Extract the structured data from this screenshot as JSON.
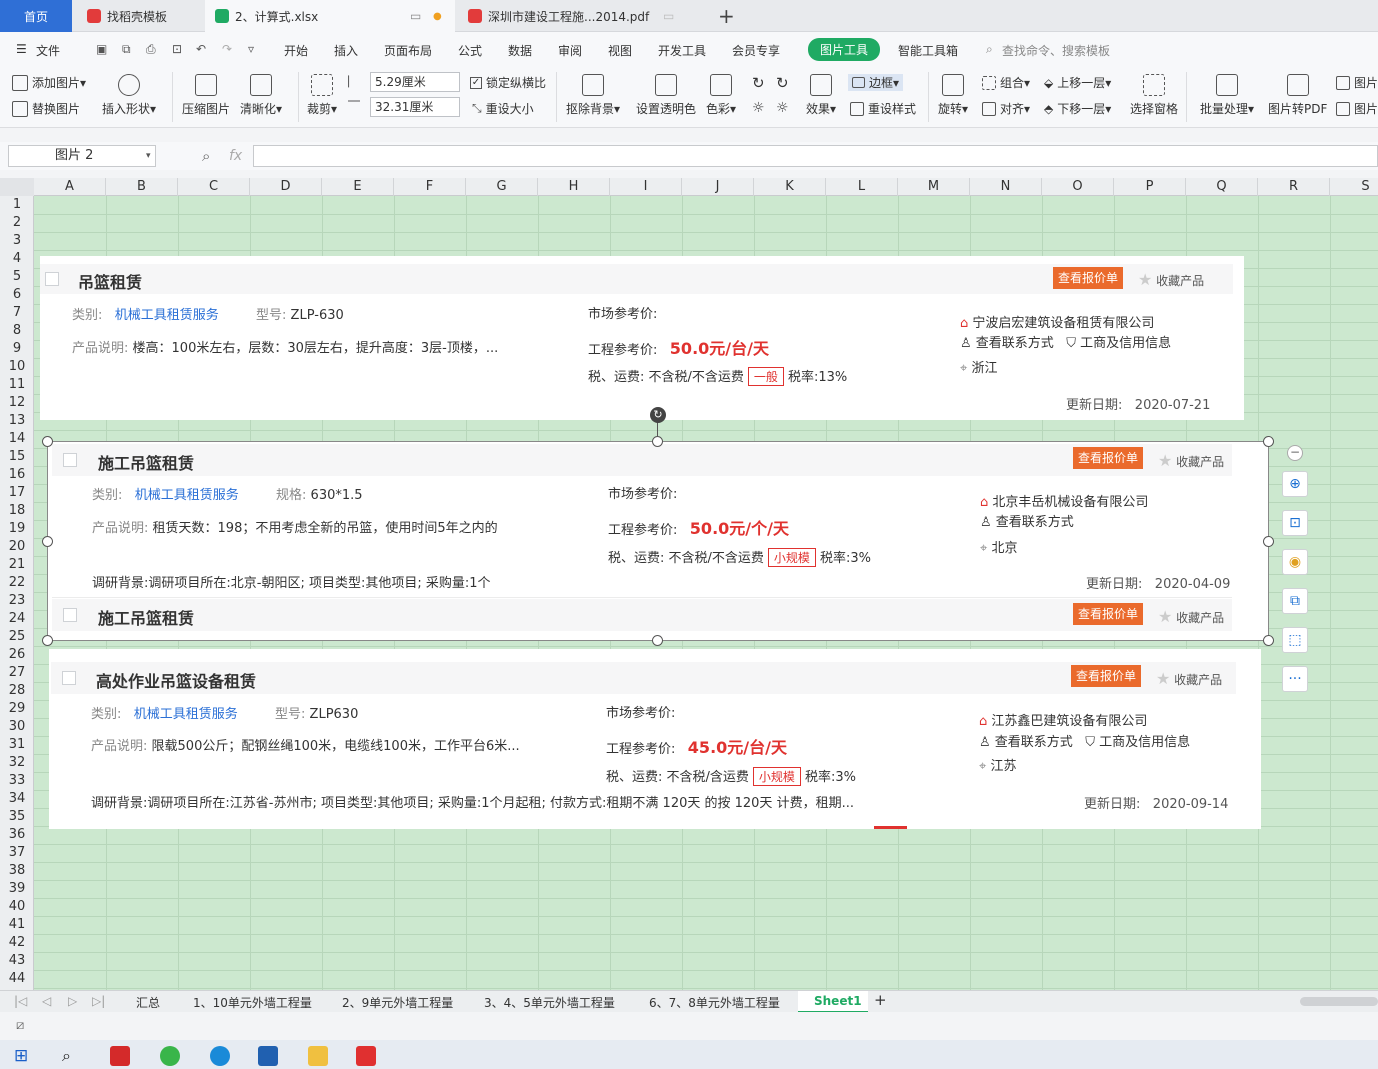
{
  "tabs": {
    "home": "首页",
    "doc": "找稻壳模板",
    "xlsx": "2、计算式.xlsx",
    "pdf": "深圳市建设工程施...2014.pdf",
    "add": "+"
  },
  "menu": {
    "file": "文件",
    "items": [
      "开始",
      "插入",
      "页面布局",
      "公式",
      "数据",
      "审阅",
      "视图",
      "开发工具",
      "会员专享",
      "图片工具",
      "智能工具箱"
    ],
    "search": "查找命令、搜索模板"
  },
  "ribbon": {
    "add_picture": "添加图片",
    "replace_picture": "替换图片",
    "insert_shape": "插入形状",
    "compress": "压缩图片",
    "sharpen": "清晰化",
    "crop": "裁剪",
    "width": "5.29厘米",
    "height": "32.31厘米",
    "lock_ratio": "锁定纵横比",
    "reset_size": "重设大小",
    "remove_bg": "抠除背景",
    "transparent": "设置透明色",
    "color": "色彩",
    "effect": "效果",
    "border": "边框",
    "reset_style": "重设样式",
    "rotate": "旋转",
    "group": "组合",
    "align": "对齐",
    "bring_forward": "上移一层",
    "send_backward": "下移一层",
    "selection_pane": "选择窗格",
    "batch": "批量处理",
    "to_pdf": "图片转PDF",
    "picture_a": "图片",
    "picture_b": "图片"
  },
  "formula": {
    "namebox": "图片 2",
    "fx": "fx"
  },
  "columns": [
    "A",
    "B",
    "C",
    "D",
    "E",
    "F",
    "G",
    "H",
    "I",
    "J",
    "K",
    "L",
    "M",
    "N",
    "O",
    "P",
    "Q",
    "R",
    "S"
  ],
  "rows": [
    "1",
    "2",
    "3",
    "4",
    "5",
    "6",
    "7",
    "8",
    "9",
    "10",
    "11",
    "12",
    "13",
    "14",
    "15",
    "16",
    "17",
    "18",
    "19",
    "20",
    "21",
    "22",
    "23",
    "24",
    "25",
    "26",
    "27",
    "28",
    "29",
    "30",
    "31",
    "32",
    "33",
    "34",
    "35",
    "36",
    "37",
    "38",
    "39",
    "40",
    "41",
    "42",
    "43",
    "44"
  ],
  "card1": {
    "title": "吊篮租赁",
    "quote_btn": "查看报价单",
    "fav": "收藏产品",
    "cat_label": "类别:",
    "cat": "机械工具租赁服务",
    "model_label": "型号:",
    "model": "ZLP-630",
    "desc_label": "产品说明:",
    "desc": "楼高：100米左右，层数：30层左右，提升高度：3层-顶楼，...",
    "market_label": "市场参考价:",
    "eng_label": "工程参考价:",
    "price": "50.0",
    "unit": "元/台/天",
    "tax_label": "税、运费:",
    "tax": "不含税/不含运费",
    "tag": "一般",
    "rate": "税率:13%",
    "company": "宁波启宏建筑设备租赁有限公司",
    "contact": "查看联系方式",
    "credit": "工商及信用信息",
    "region": "浙江",
    "date_label": "更新日期:",
    "date": "2020-07-21"
  },
  "card2": {
    "title": "施工吊篮租赁",
    "quote_btn": "查看报价单",
    "fav": "收藏产品",
    "cat_label": "类别:",
    "cat": "机械工具租赁服务",
    "model_label": "规格:",
    "model": "630*1.5",
    "desc_label": "产品说明:",
    "desc": "租赁天数：198；不用考虑全新的吊篮，使用时间5年之内的",
    "market_label": "市场参考价:",
    "eng_label": "工程参考价:",
    "price": "50.0",
    "unit": "元/个/天",
    "tax_label": "税、运费:",
    "tax": "不含税/不含运费",
    "tag": "小规模",
    "rate": "税率:3%",
    "company": "北京丰岳机械设备有限公司",
    "contact": "查看联系方式",
    "region": "北京",
    "research_label": "调研背景:",
    "research": "调研项目所在:北京-朝阳区;    项目类型:其他项目;    采购量:1个",
    "date_label": "更新日期:",
    "date": "2020-04-09",
    "next_title": "施工吊篮租赁",
    "next_quote": "查看报价单",
    "next_fav": "收藏产品"
  },
  "card3": {
    "title": "高处作业吊篮设备租赁",
    "quote_btn": "查看报价单",
    "fav": "收藏产品",
    "cat_label": "类别:",
    "cat": "机械工具租赁服务",
    "model_label": "型号:",
    "model": "ZLP630",
    "desc_label": "产品说明:",
    "desc": "限载500公斤；配钢丝绳100米，电缆线100米，工作平台6米...",
    "market_label": "市场参考价:",
    "eng_label": "工程参考价:",
    "price": "45.0",
    "unit": "元/台/天",
    "tax_label": "税、运费:",
    "tax": "不含税/含运费",
    "tag": "小规模",
    "rate": "税率:3%",
    "company": "江苏鑫巴建筑设备有限公司",
    "contact": "查看联系方式",
    "credit": "工商及信用信息",
    "region": "江苏",
    "research_label": "调研背景:",
    "research": "调研项目所在:江苏省-苏州市;    项目类型:其他项目;    采购量:1个月起租;    付款方式:租期不满 120天 的按 120天 计费，租期...",
    "date_label": "更新日期:",
    "date": "2020-09-14"
  },
  "sheet_tabs": [
    "汇总",
    "1、10单元外墙工程量",
    "2、9单元外墙工程量",
    "3、4、5单元外墙工程量",
    "6、7、8单元外墙工程量",
    "Sheet1"
  ],
  "colors": {
    "accent": "#1faa63",
    "sheet_bg": "#cce8cf",
    "price": "#e0322f",
    "link": "#2a6fd6",
    "quote_btn": "#ea6a2c"
  }
}
